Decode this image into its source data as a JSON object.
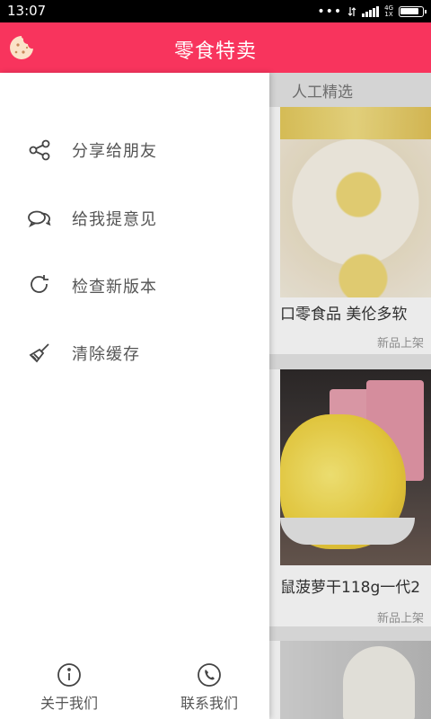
{
  "status_bar": {
    "time": "13:07",
    "network_label": "4G\n1X"
  },
  "app_bar": {
    "title": "零食特卖",
    "menu_icon": "cookie-icon",
    "color": "#f8345d"
  },
  "drawer": {
    "menu": [
      {
        "label": "分享给朋友",
        "icon": "share-icon"
      },
      {
        "label": "给我提意见",
        "icon": "chat-bubbles-icon"
      },
      {
        "label": "检查新版本",
        "icon": "refresh-icon"
      },
      {
        "label": "清除缓存",
        "icon": "broom-icon"
      }
    ],
    "footer": [
      {
        "label": "关于我们",
        "icon": "info-icon"
      },
      {
        "label": "联系我们",
        "icon": "phone-icon"
      }
    ]
  },
  "content": {
    "section_title": "人工精选",
    "products": [
      {
        "name": "口零食品 美伦多软",
        "badge": "新品上架"
      },
      {
        "name": "鼠菠萝干118g一代2",
        "badge": "新品上架"
      }
    ]
  }
}
